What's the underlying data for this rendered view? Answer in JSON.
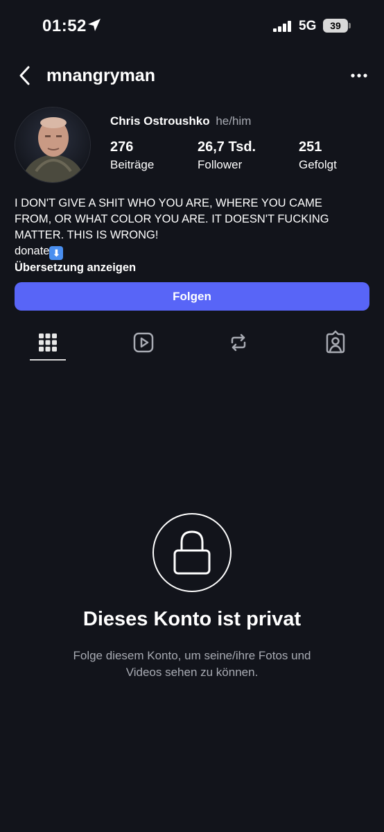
{
  "status_bar": {
    "time": "01:52",
    "network": "5G",
    "battery": "39"
  },
  "header": {
    "username": "mnangryman",
    "back_icon": "chevron-left-icon",
    "more_icon": "more-horizontal-icon"
  },
  "profile": {
    "full_name": "Chris Ostroushko",
    "pronouns": "he/him",
    "stats": [
      {
        "value": "276",
        "label": "Beiträge"
      },
      {
        "value": "26,7 Tsd.",
        "label": "Follower"
      },
      {
        "value": "251",
        "label": "Gefolgt"
      }
    ],
    "bio_lines": [
      "I DON'T GIVE A SHIT WHO YOU ARE, WHERE YOU CAME",
      "FROM, OR WHAT COLOR YOU ARE. IT DOESN'T FUCKING",
      "MATTER. THIS IS WRONG!"
    ],
    "donate_text": "donate",
    "donate_emoji": "⬇",
    "translate_link": "Übersetzung anzeigen"
  },
  "follow_button": {
    "label": "Folgen",
    "color": "#5865f7"
  },
  "tabs": [
    {
      "icon": "grid-icon",
      "active": true
    },
    {
      "icon": "reels-icon",
      "active": false
    },
    {
      "icon": "repost-icon",
      "active": false
    },
    {
      "icon": "tagged-icon",
      "active": false
    }
  ],
  "private_notice": {
    "icon": "lock-icon",
    "title": "Dieses Konto ist privat",
    "subtitle_line1": "Folge diesem Konto, um seine/ihre Fotos und",
    "subtitle_line2": "Videos sehen zu können."
  },
  "colors": {
    "background": "#12141b",
    "accent": "#5865f7",
    "secondary_text": "#a8abb3"
  }
}
